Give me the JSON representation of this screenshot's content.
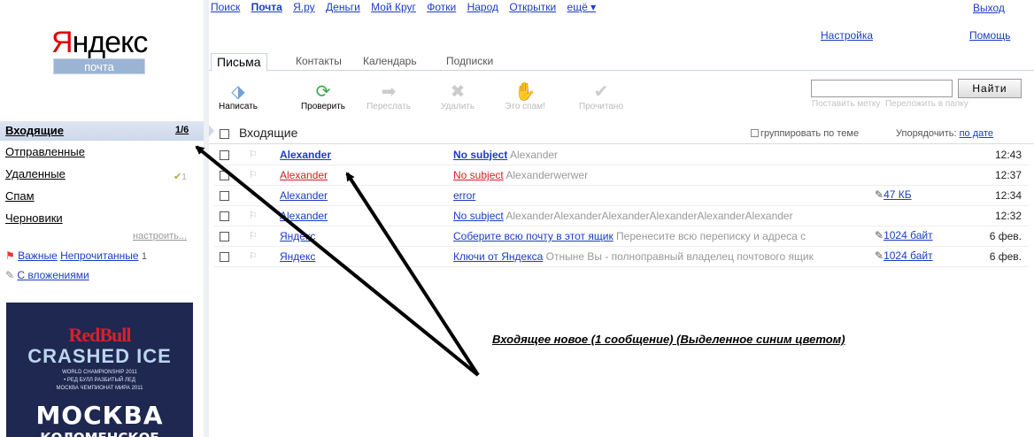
{
  "logo": {
    "brand": "Яндекс",
    "brand_first": "Я",
    "brand_rest": "ндекс",
    "service": "почта"
  },
  "topnav": {
    "items": [
      "Поиск",
      "Почта",
      "Я.ру",
      "Деньги",
      "Мой Круг",
      "Фотки",
      "Народ",
      "Открытки",
      "ещё ▾"
    ],
    "current": "Почта",
    "exit": "Выход",
    "settings": "Настройка",
    "help": "Помощь"
  },
  "tabs": [
    "Письма",
    "Контакты",
    "Календарь",
    "Подписки"
  ],
  "toolbar": {
    "buttons": [
      {
        "label": "Написать",
        "icon": "compose-icon",
        "enabled": true
      },
      {
        "label": "Проверить",
        "icon": "refresh-icon",
        "enabled": true
      },
      {
        "label": "Переслать",
        "icon": "forward-icon",
        "enabled": false
      },
      {
        "label": "Удалить",
        "icon": "delete-icon",
        "enabled": false
      },
      {
        "label": "Это спам!",
        "icon": "spam-icon",
        "enabled": false
      },
      {
        "label": "Прочитано",
        "icon": "read-check-icon",
        "enabled": false
      }
    ],
    "search_button": "Найти",
    "search_value": "",
    "tag_link": "Поставить метку",
    "move_link": "Переложить в папку"
  },
  "sidebar": {
    "inbox": {
      "label": "Входящие",
      "count": "1/6"
    },
    "folders": [
      "Отправленные",
      "Удаленные",
      "Спам",
      "Черновики"
    ],
    "trash_count": "1",
    "setup": "настроить...",
    "filters": {
      "important": "Важные",
      "unread": "Непрочитанные",
      "unread_count": "1",
      "with_attachments": "С вложениями"
    }
  },
  "banner": {
    "brand": "RedBull",
    "event": "CRASHED ICE",
    "line1": "WORLD CHAMPIONSHIP 2011",
    "line2": "• РЕД БУЛЛ РАЗБИТЫЙ ЛЕД",
    "line3": "МОСКВА ЧЕМПИОНАТ МИРА 2011",
    "city": "МОСКВА",
    "place": "КОЛОМЕНСКОЕ"
  },
  "list": {
    "title": "Входящие",
    "group_by_topic": "группировать по теме",
    "sort_label": "Упорядочить:",
    "sort_value": "по дате",
    "messages": [
      {
        "from": "Alexander",
        "subject": "No subject",
        "snippet": "Alexander",
        "attachment": "",
        "time": "12:43",
        "state": "new"
      },
      {
        "from": "Alexander",
        "subject": "No subject",
        "snippet": "Alexanderwerwer",
        "attachment": "",
        "time": "12:37",
        "state": "red"
      },
      {
        "from": "Alexander",
        "subject": "error",
        "snippet": "",
        "attachment": "47 КБ",
        "time": "12:34",
        "state": "read"
      },
      {
        "from": "Alexander",
        "subject": "No subject",
        "snippet": "AlexanderAlexanderAlexanderAlexanderAlexanderAlexander",
        "attachment": "",
        "time": "12:32",
        "state": "read"
      },
      {
        "from": "Яндекс",
        "subject": "Соберите всю почту в этот ящик",
        "snippet": "Перенесите всю переписку и адреса с",
        "attachment": "1024 байт",
        "time": "6 фев.",
        "state": "read"
      },
      {
        "from": "Яндекс",
        "subject": "Ключи от Яндекса",
        "snippet": "Отныне Вы - полноправный владелец почтового ящик",
        "attachment": "1024 байт",
        "time": "6 фев.",
        "state": "read"
      }
    ]
  },
  "annotation": {
    "text": "Входящее новое  (1 сообщение) (Выделенное синим цветом)"
  },
  "colors": {
    "link": "#1a3dc1",
    "brand_red": "#e00000",
    "selected_folder": "#cdd8ea",
    "unread_red": "#d02020"
  }
}
